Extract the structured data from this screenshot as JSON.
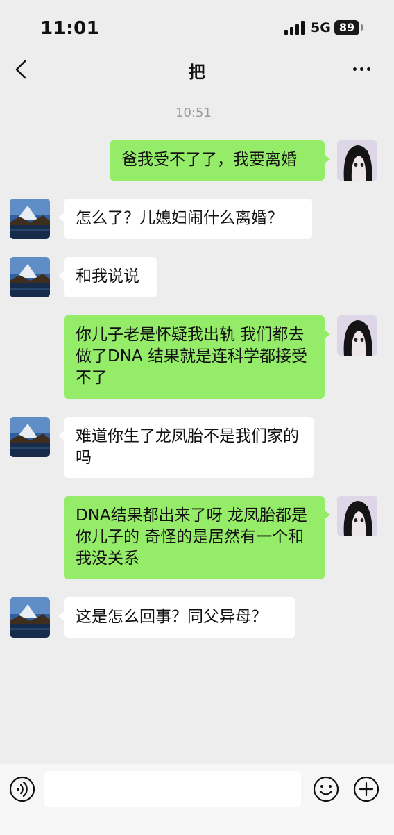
{
  "status_bar": {
    "time": "11:01",
    "network": "5G",
    "battery": "89"
  },
  "nav": {
    "title": "把"
  },
  "chat": {
    "timestamp": "10:51",
    "messages": [
      {
        "side": "mine",
        "text": "爸我受不了了，我要离婚"
      },
      {
        "side": "theirs",
        "text": "怎么了？儿媳妇闹什么离婚？"
      },
      {
        "side": "theirs",
        "text": "和我说说"
      },
      {
        "side": "mine",
        "text": "你儿子老是怀疑我出轨 我们都去做了DNA 结果就是连科学都接受不了"
      },
      {
        "side": "theirs",
        "text": "难道你生了龙凤胎不是我们家的吗"
      },
      {
        "side": "mine",
        "text": "DNA结果都出来了呀 龙凤胎都是你儿子的 奇怪的是居然有一个和我没关系"
      },
      {
        "side": "theirs",
        "text": "这是怎么回事？同父异母？"
      }
    ]
  },
  "input_bar": {
    "value": "",
    "placeholder": ""
  },
  "colors": {
    "background": "#ededed",
    "mine_bubble": "#95ec69",
    "theirs_bubble": "#ffffff",
    "timestamp": "#9a9a9a"
  },
  "icons": {
    "back": "chevron-left-icon",
    "more": "more-dots-icon",
    "voice": "voice-icon",
    "emoji": "emoji-icon",
    "plus": "plus-icon"
  }
}
